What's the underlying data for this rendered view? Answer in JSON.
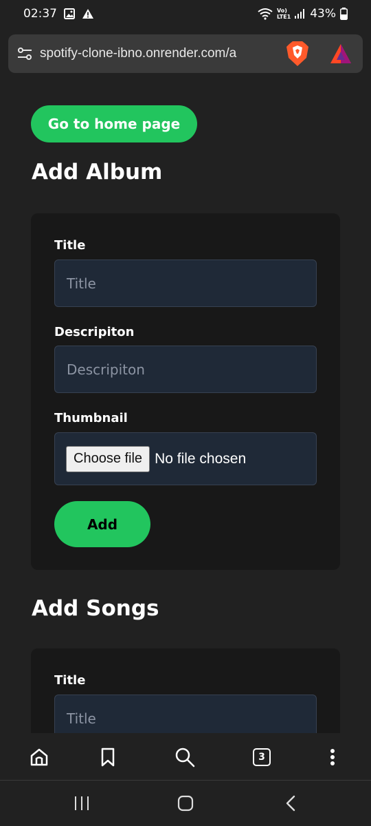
{
  "status_bar": {
    "time": "02:37",
    "battery": "43%",
    "network_label_top": "Vo)",
    "network_label_bottom": "LTE1"
  },
  "address_bar": {
    "url": "spotify-clone-ibno.onrender.com/a"
  },
  "page": {
    "home_button": "Go to home page",
    "album_section": {
      "title": "Add Album",
      "title_label": "Title",
      "title_placeholder": "Title",
      "description_label": "Descripiton",
      "description_placeholder": "Descripiton",
      "thumbnail_label": "Thumbnail",
      "choose_file": "Choose file",
      "file_status": "No file chosen",
      "add_button": "Add"
    },
    "songs_section": {
      "title": "Add Songs",
      "title_label": "Title",
      "title_placeholder": "Title"
    }
  },
  "browser_toolbar": {
    "tab_count": "3"
  },
  "colors": {
    "accent_green": "#22c55e",
    "background": "#212121",
    "card": "#181818",
    "input_bg": "#1f2937"
  }
}
